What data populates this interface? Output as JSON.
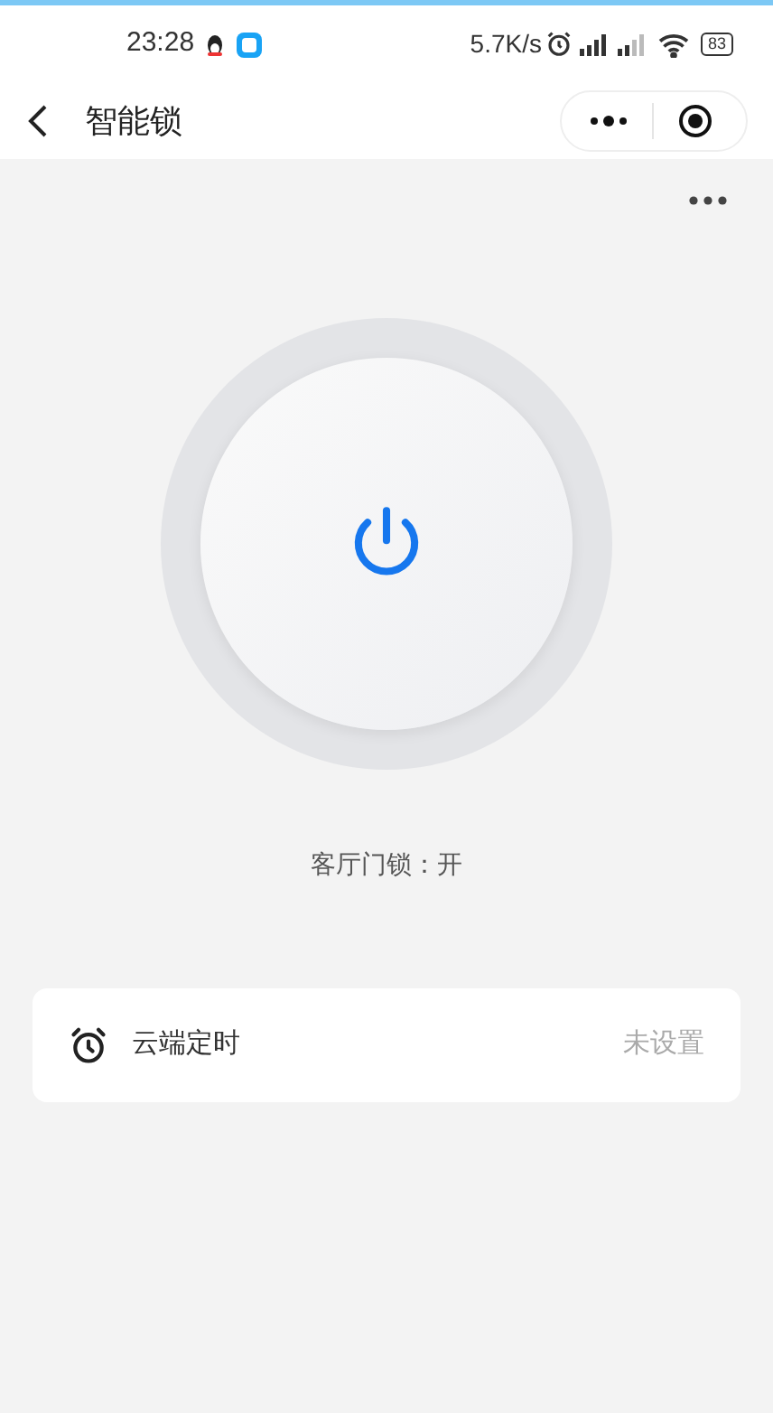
{
  "status_bar": {
    "time": "23:28",
    "speed": "5.7K/s",
    "battery": "83"
  },
  "nav": {
    "title": "智能锁"
  },
  "lock": {
    "on": true,
    "label": "客厅门锁：开"
  },
  "timer": {
    "label": "云端定时",
    "value": "未设置"
  }
}
